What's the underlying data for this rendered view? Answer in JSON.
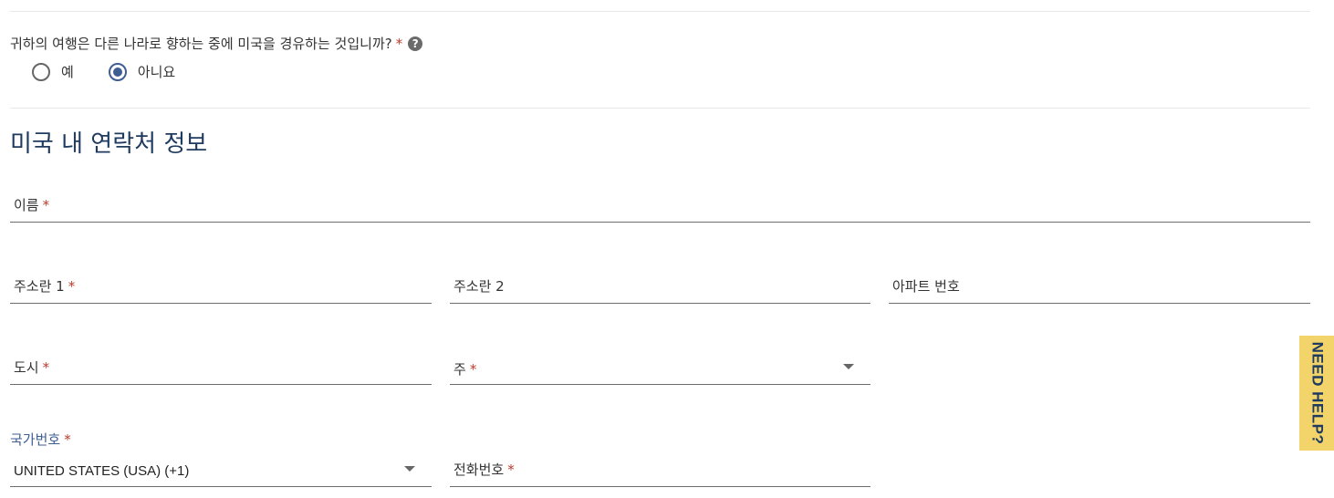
{
  "transit_question": {
    "text": "귀하의 여행은 다른 나라로 향하는 중에 미국을 경유하는 것입니까?",
    "required_mark": "*",
    "help_icon": "question-circle-icon",
    "options": [
      {
        "label": "예",
        "selected": false
      },
      {
        "label": "아니요",
        "selected": true
      }
    ]
  },
  "section": {
    "title": "미국 내 연락처 정보"
  },
  "fields": {
    "name": {
      "label": "이름",
      "required": "*"
    },
    "address1": {
      "label": "주소란 1",
      "required": "*"
    },
    "address2": {
      "label": "주소란 2"
    },
    "apartment": {
      "label": "아파트 번호"
    },
    "city": {
      "label": "도시",
      "required": "*"
    },
    "state": {
      "label": "주",
      "required": "*"
    },
    "country_code": {
      "label": "국가번호",
      "required": "*",
      "value": "UNITED STATES (USA) (+1)"
    },
    "phone": {
      "label": "전화번호",
      "required": "*"
    }
  },
  "need_help": {
    "label": "NEED HELP?"
  },
  "colors": {
    "accent": "#3f5f93",
    "title": "#1f3a5f",
    "required": "#c0392b",
    "help_tab": "#f3d46b"
  }
}
